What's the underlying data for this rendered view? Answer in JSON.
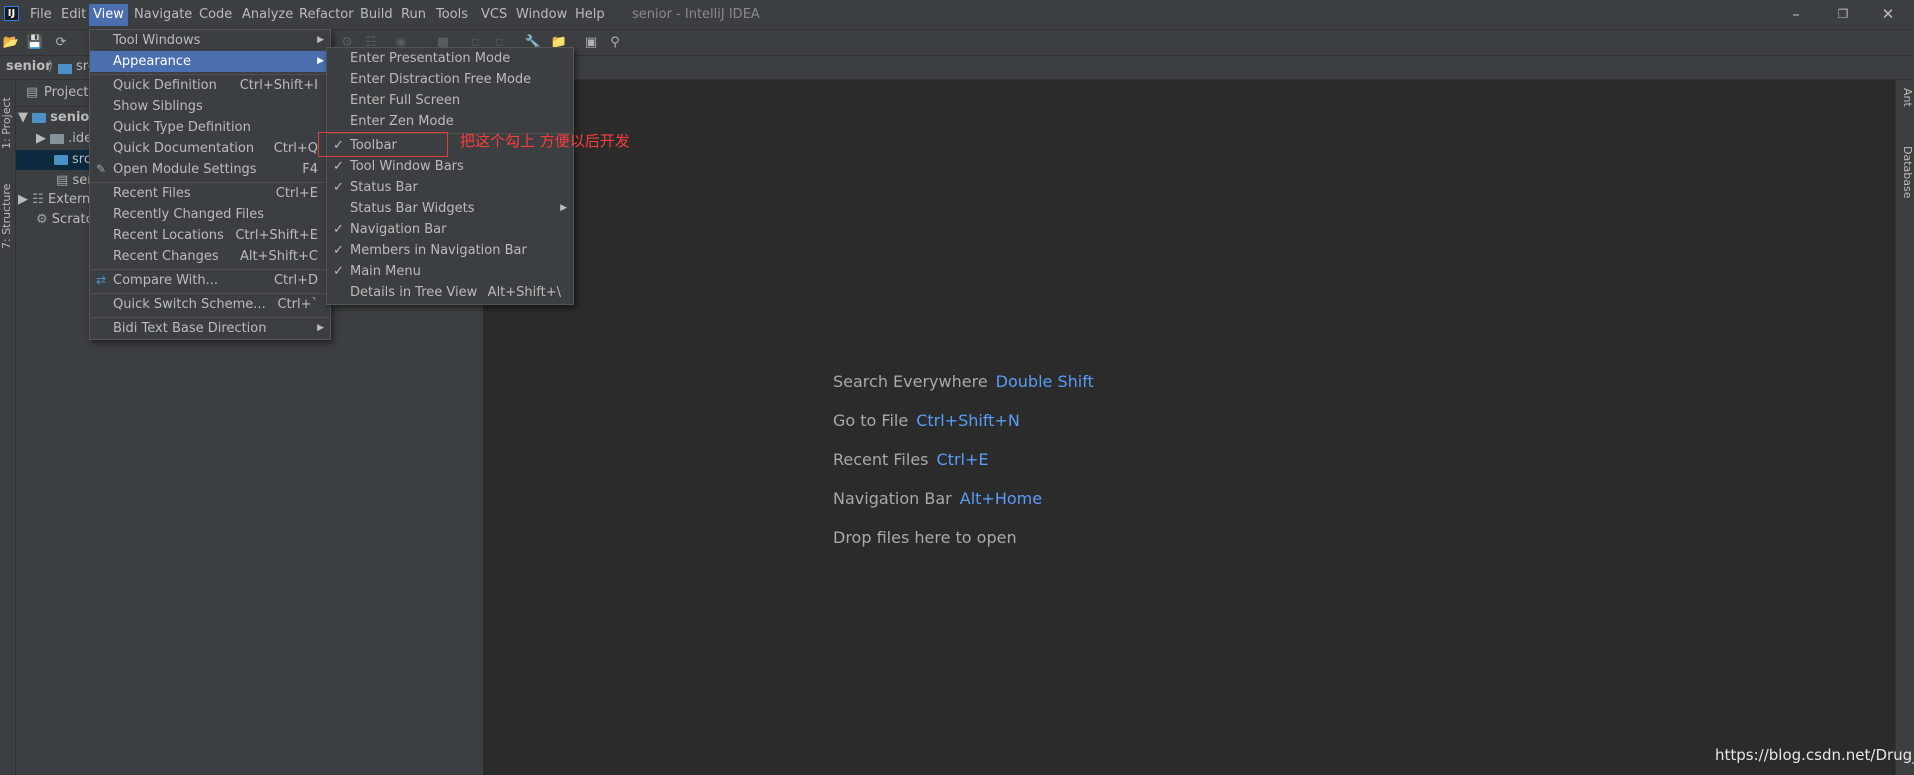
{
  "window": {
    "title": "senior - IntelliJ IDEA",
    "logo": "IJ",
    "controls": [
      "minimize-icon",
      "restore-icon",
      "close-icon"
    ]
  },
  "menubar": [
    "File",
    "Edit",
    "View",
    "Navigate",
    "Code",
    "Analyze",
    "Refactor",
    "Build",
    "Run",
    "Tools",
    "VCS",
    "Window",
    "Help"
  ],
  "navbar": {
    "project": "senior",
    "path": "src"
  },
  "left_strip": {
    "project_tab": "1: Project",
    "structure_tab": "7: Structure"
  },
  "right_strip": {
    "ant_tab": "Ant",
    "database_tab": "Database"
  },
  "project_panel": {
    "title": "Project",
    "rows": [
      {
        "label": "senior",
        "icon": "folder-icon"
      },
      {
        "label": ".idea",
        "icon": "folder-icon"
      },
      {
        "label": "src",
        "icon": "folder-icon"
      },
      {
        "label": "senior.iml",
        "icon": "file-icon"
      },
      {
        "label": "External Libraries",
        "icon": "library-icon"
      },
      {
        "label": "Scratches and Consoles",
        "icon": "scratch-icon"
      }
    ]
  },
  "view_menu": {
    "items": [
      {
        "label": "Tool Windows",
        "shortcut": "",
        "submenu": true
      },
      {
        "label": "Appearance",
        "shortcut": "",
        "submenu": true,
        "highlighted": true
      },
      {
        "label": "Quick Definition",
        "shortcut": "Ctrl+Shift+I"
      },
      {
        "label": "Show Siblings",
        "shortcut": ""
      },
      {
        "label": "Quick Type Definition",
        "shortcut": ""
      },
      {
        "label": "Quick Documentation",
        "shortcut": "Ctrl+Q"
      },
      {
        "label": "Open Module Settings",
        "shortcut": "F4",
        "icon": "wrench-icon"
      },
      {
        "label": "Recent Files",
        "shortcut": "Ctrl+E"
      },
      {
        "label": "Recently Changed Files",
        "shortcut": ""
      },
      {
        "label": "Recent Locations",
        "shortcut": "Ctrl+Shift+E"
      },
      {
        "label": "Recent Changes",
        "shortcut": "Alt+Shift+C"
      },
      {
        "label": "Compare With...",
        "shortcut": "Ctrl+D",
        "icon": "compare-icon"
      },
      {
        "label": "Quick Switch Scheme...",
        "shortcut": "Ctrl+`"
      },
      {
        "label": "Bidi Text Base Direction",
        "shortcut": "",
        "submenu": true
      }
    ]
  },
  "appearance_menu": {
    "items": [
      {
        "label": "Enter Presentation Mode",
        "checked": false
      },
      {
        "label": "Enter Distraction Free Mode",
        "checked": false
      },
      {
        "label": "Enter Full Screen",
        "checked": false
      },
      {
        "label": "Enter Zen Mode",
        "checked": false
      },
      {
        "label": "Toolbar",
        "checked": true
      },
      {
        "label": "Tool Window Bars",
        "checked": true
      },
      {
        "label": "Status Bar",
        "checked": true
      },
      {
        "label": "Status Bar Widgets",
        "checked": false,
        "submenu": true
      },
      {
        "label": "Navigation Bar",
        "checked": true
      },
      {
        "label": "Members in Navigation Bar",
        "checked": true
      },
      {
        "label": "Main Menu",
        "checked": true
      },
      {
        "label": "Details in Tree View",
        "checked": false,
        "shortcut": "Alt+Shift+\\"
      }
    ]
  },
  "annotation": "把这个勾上 方便以后开发",
  "editor_hints": [
    {
      "text": "Search Everywhere",
      "key": "Double Shift"
    },
    {
      "text": "Go to File",
      "key": "Ctrl+Shift+N"
    },
    {
      "text": "Recent Files",
      "key": "Ctrl+E"
    },
    {
      "text": "Navigation Bar",
      "key": "Alt+Home"
    },
    {
      "text": "Drop files here to open",
      "key": ""
    }
  ],
  "watermark": "https://blog.csdn.net/Drug_",
  "colors": {
    "accent": "#4b6eaf",
    "hint_key": "#589df6",
    "annotation": "#e23b3b",
    "background": "#2b2b2b",
    "panel": "#3c3f41"
  }
}
